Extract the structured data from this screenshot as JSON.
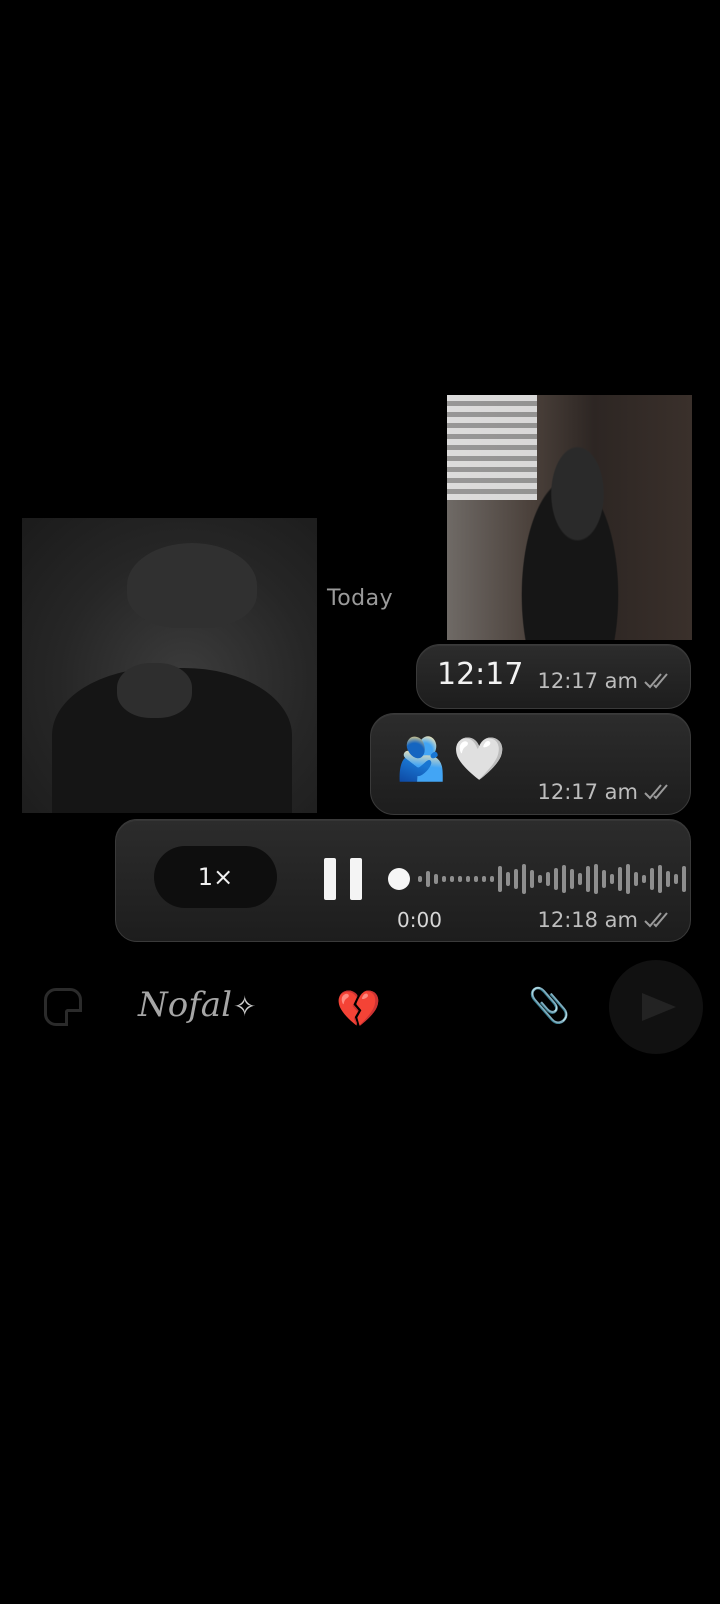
{
  "chat": {
    "date_separator": "Today",
    "messages": [
      {
        "type": "image",
        "side": "left",
        "description_icon": "photo"
      },
      {
        "type": "image",
        "side": "right",
        "description_icon": "photo"
      },
      {
        "type": "text",
        "text": "12:17",
        "time": "12:17 am"
      },
      {
        "type": "emoji",
        "text": "🫂🤍",
        "time": "12:17 am"
      },
      {
        "type": "voice",
        "speed": "1×",
        "elapsed": "0:00",
        "time": "12:18 am",
        "state": "playing",
        "progress": 0
      }
    ]
  },
  "input_bar": {
    "name_text": "Nofal",
    "sparkle": "✧",
    "broken_heart": "💔",
    "attach_icon": "paperclip-icon",
    "send_icon": "send-icon"
  },
  "colors": {
    "background": "#000000",
    "bubble": "#262626",
    "text": "#f2f2f2",
    "meta": "#bdbdbd"
  }
}
